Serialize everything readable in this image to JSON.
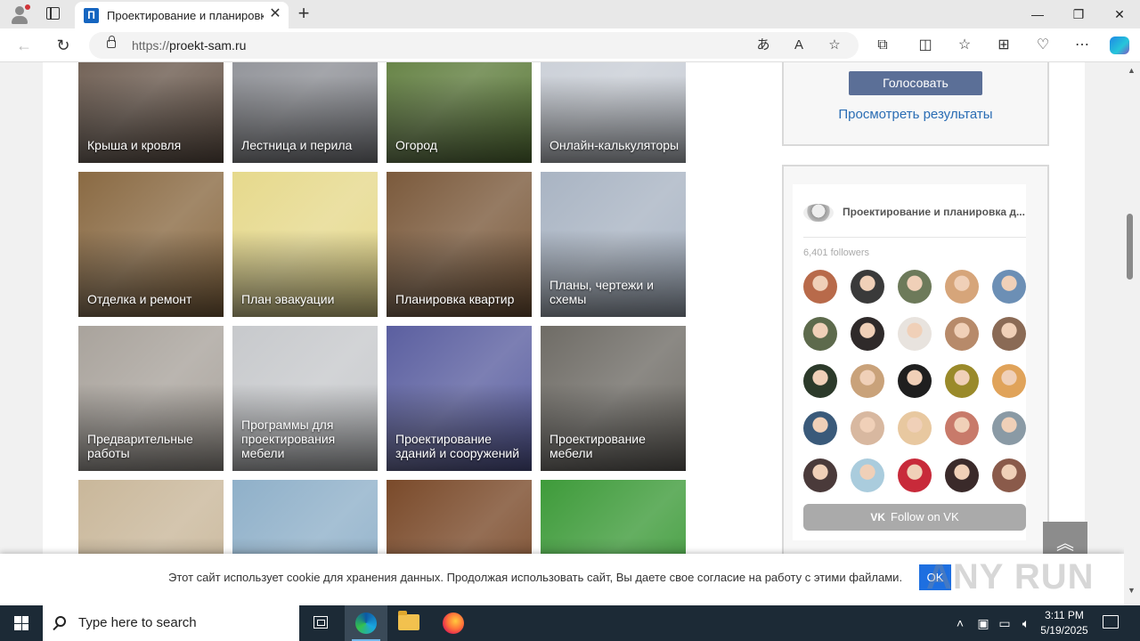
{
  "browser": {
    "tab_title": "Проектирование и планировка д",
    "favicon_letter": "П",
    "url_protocol": "https://",
    "url_host": "proekt-sam.ru",
    "icons": [
      "back-icon",
      "refresh-icon",
      "lock-icon",
      "translate-icon",
      "read-aloud-icon",
      "favorite-star-icon",
      "extensions-icon",
      "split-screen-icon",
      "favorites-icon",
      "collections-icon",
      "performance-icon",
      "more-icon",
      "copilot-icon"
    ]
  },
  "tiles": [
    {
      "caption": "Крыша и кровля",
      "bg": "#6b5a4e"
    },
    {
      "caption": "Лестница и перила",
      "bg": "#8d8f95"
    },
    {
      "caption": "Огород",
      "bg": "#5f7d3d"
    },
    {
      "caption": "Онлайн-калькуляторы",
      "bg": "#c9ced6"
    },
    {
      "caption": "Отделка и ремонт",
      "bg": "#8a6a43"
    },
    {
      "caption": "План эвакуации",
      "bg": "#e6d98c"
    },
    {
      "caption": "Планировка квартир",
      "bg": "#7b5a3c"
    },
    {
      "caption": "Планы, чертежи и схемы",
      "bg": "#a9b4c3"
    },
    {
      "caption": "Предварительные работы",
      "bg": "#a9a39c"
    },
    {
      "caption": "Программы для проектирования мебели",
      "bg": "#c7c9cc"
    },
    {
      "caption": "Проектирование зданий и сооружений",
      "bg": "#5b5fa0"
    },
    {
      "caption": "Проектирование мебели",
      "bg": "#6f6c66"
    },
    {
      "caption": "",
      "bg": "#c9b79a"
    },
    {
      "caption": "",
      "bg": "#8fb0c9"
    },
    {
      "caption": "",
      "bg": "#7a4a2a"
    },
    {
      "caption": "",
      "bg": "#3e9b3a"
    }
  ],
  "poll": {
    "vote_button": "Голосовать",
    "results_link": "Просмотреть результаты"
  },
  "vk_widget": {
    "title": "Проектирование и планировка д...",
    "followers": "6,401 followers",
    "follow_button": "Follow on VK",
    "vk_mark": "VK",
    "avatar_colors": [
      "#b86a4a",
      "#3a3a3a",
      "#6d7a5a",
      "#d6a57a",
      "#6c8fb5",
      "#5d6a4c",
      "#2f2a2a",
      "#e8e3de",
      "#b78a6a",
      "#8a6a55",
      "#2c3a2a",
      "#c9a27a",
      "#1f1f1f",
      "#9a8a2a",
      "#e0a35a",
      "#3a5a7a",
      "#d8b8a0",
      "#e8c8a0",
      "#c87a6a",
      "#8a9aa5",
      "#4a3a3a",
      "#aaccdd",
      "#c82a3a",
      "#3a2a2a",
      "#8a5a4a"
    ]
  },
  "scroll_top_icon": "chevrons-up-icon",
  "cookie": {
    "text": "Этот сайт использует cookie для хранения данных. Продолжая использовать сайт, Вы даете свое согласие на работу с этими файлами.",
    "ok": "OK",
    "watermark": "ANY RUN"
  },
  "taskbar": {
    "search_placeholder": "Type here to search",
    "time": "3:11 PM",
    "date": "5/19/2025",
    "tray_icons": [
      "chevron-up-icon",
      "network-icon",
      "volume-icon",
      "notifications-icon"
    ]
  }
}
